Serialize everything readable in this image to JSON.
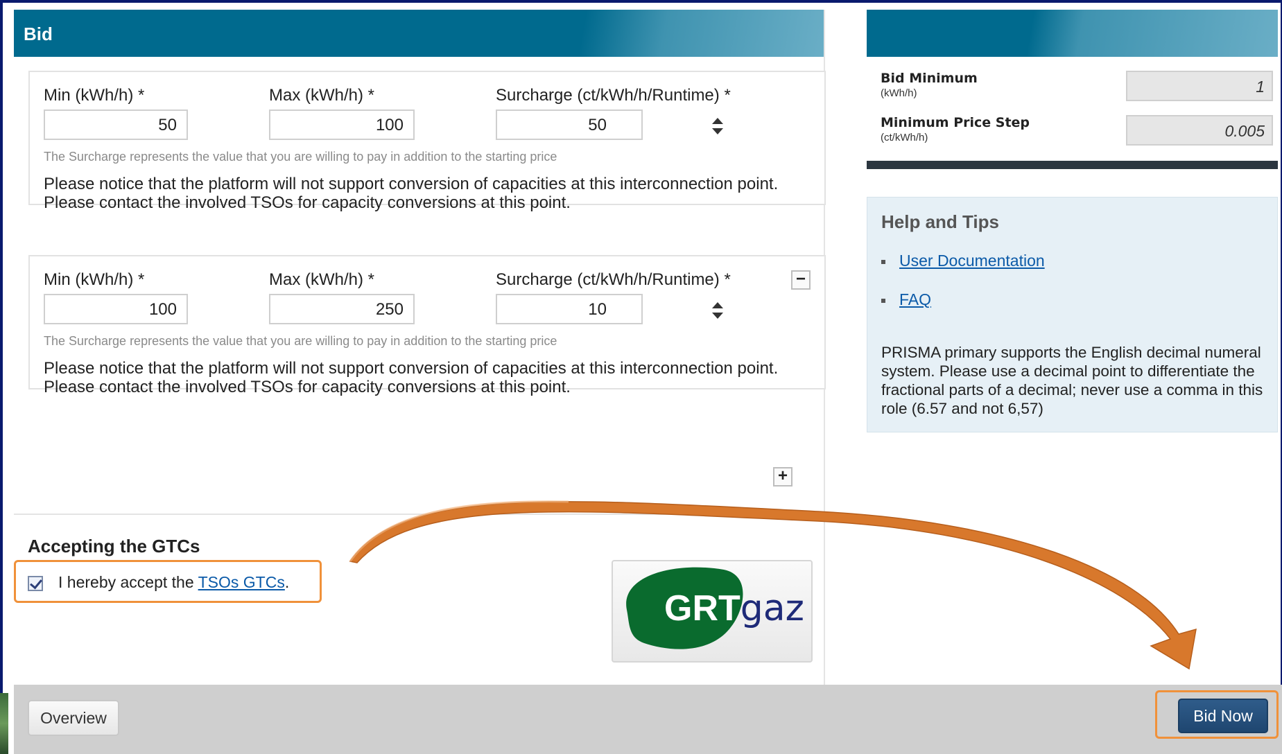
{
  "bid_panel": {
    "title": "Bid",
    "rows": [
      {
        "min_label": "Min (kWh/h) *",
        "min_value": "50",
        "max_label": "Max (kWh/h) *",
        "max_value": "100",
        "surcharge_label": "Surcharge (ct/kWh/h/Runtime) *",
        "surcharge_value": "50",
        "hint": "The Surcharge represents the value that you are willing to pay in addition to the starting price",
        "notice_line1": "Please notice that the platform will not support conversion of capacities at this interconnection point.",
        "notice_line2": "Please contact the involved TSOs for capacity conversions at this point."
      },
      {
        "min_label": "Min (kWh/h) *",
        "min_value": "100",
        "max_label": "Max (kWh/h) *",
        "max_value": "250",
        "surcharge_label": "Surcharge (ct/kWh/h/Runtime) *",
        "surcharge_value": "10",
        "hint": "The Surcharge represents the value that you are willing to pay in addition to the starting price",
        "notice_line1": "Please notice that the platform will not support conversion of capacities at this interconnection point.",
        "notice_line2": "Please contact the involved TSOs for capacity conversions at this point."
      }
    ],
    "remove_label": "−",
    "add_label": "+"
  },
  "gtc": {
    "title": "Accepting the GTCs",
    "accept_text": "I hereby accept the ",
    "link_text": "TSOs GTCs",
    "after_text": ".",
    "checked": true
  },
  "logo": {
    "grt": "GRT",
    "gaz": "gaz",
    "brand_green": "#0a6b2e",
    "brand_blue": "#1e2a78"
  },
  "info": {
    "bid_minimum_label": "Bid Minimum",
    "bid_minimum_unit": "(kWh/h)",
    "bid_minimum_value": "1",
    "price_step_label": "Minimum Price Step",
    "price_step_unit": "(ct/kWh/h)",
    "price_step_value": "0.005"
  },
  "help": {
    "title": "Help and Tips",
    "links": [
      "User Documentation",
      "FAQ"
    ],
    "text": "PRISMA primary supports the English decimal numeral system. Please use a decimal point to differentiate the fractional parts of a decimal; never use a comma in this role (6.57 and not 6,57)"
  },
  "footer": {
    "overview_label": "Overview",
    "bid_now_label": "Bid Now"
  },
  "colors": {
    "header_blue": "#006a8e",
    "highlight_orange": "#f0913a",
    "arrow_orange": "#d8782c",
    "frame_navy": "#0a1a6e"
  }
}
